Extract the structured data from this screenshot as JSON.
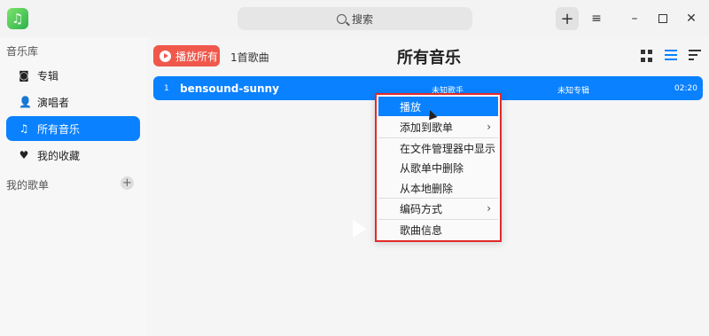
{
  "titlebar": {
    "search_placeholder": "搜索",
    "add_icon": "+",
    "menu_icon": "≡",
    "min_icon": "–",
    "close_icon": "✕"
  },
  "sidebar": {
    "library_title": "音乐库",
    "items": [
      {
        "label": "专辑",
        "icon": "album-icon"
      },
      {
        "label": "演唱者",
        "icon": "singer-icon"
      },
      {
        "label": "所有音乐",
        "icon": "music-note-icon"
      },
      {
        "label": "我的收藏",
        "icon": "heart-icon"
      }
    ],
    "playlist_title": "我的歌单",
    "add_playlist": "+"
  },
  "main": {
    "play_all_label": "播放所有",
    "song_count": "1首歌曲",
    "title": "所有音乐",
    "songs": [
      {
        "num": "1",
        "title": "bensound-sunny",
        "artist": "未知歌手",
        "album": "未知专辑",
        "duration": "02:20"
      }
    ]
  },
  "context_menu": {
    "items": [
      {
        "label": "播放",
        "submenu": false
      },
      {
        "label": "添加到歌单",
        "submenu": true
      },
      {
        "label": "在文件管理器中显示",
        "submenu": false
      },
      {
        "label": "从歌单中删除",
        "submenu": false
      },
      {
        "label": "从本地删除",
        "submenu": false
      },
      {
        "label": "编码方式",
        "submenu": true
      },
      {
        "label": "歌曲信息",
        "submenu": false
      }
    ],
    "arrow": "›"
  },
  "colors": {
    "accent": "#0a81ff",
    "play_all": "#f0584b",
    "highlight_border": "#e02a2a"
  }
}
